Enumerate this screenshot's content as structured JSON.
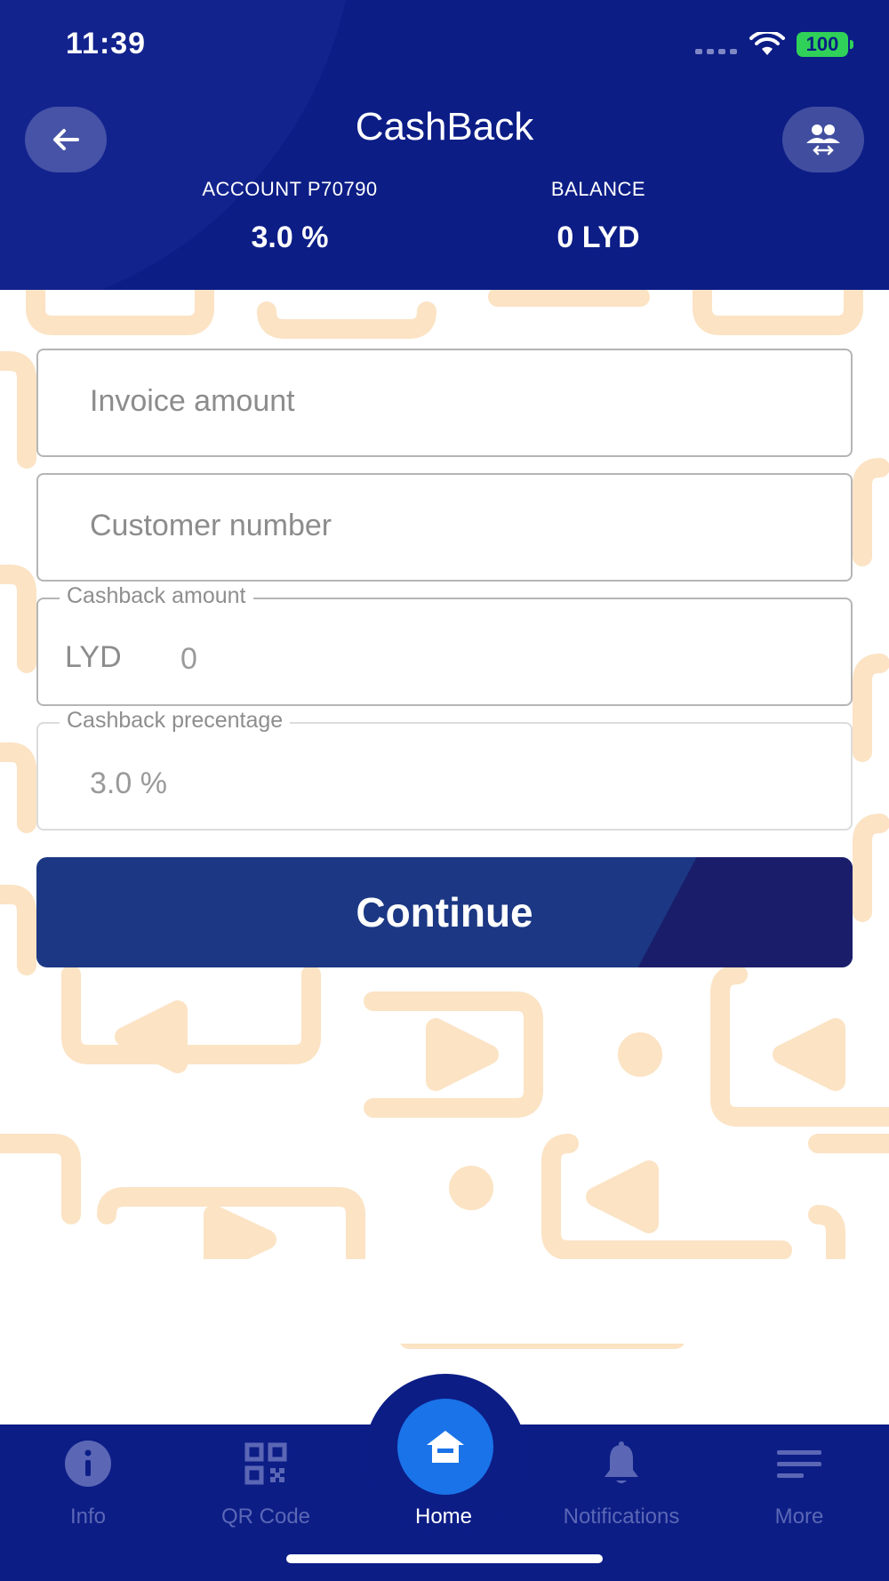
{
  "status_bar": {
    "time": "11:39",
    "battery": "100"
  },
  "header": {
    "title": "CashBack",
    "account_label": "ACCOUNT P70790",
    "account_value": "3.0 %",
    "balance_label": "BALANCE",
    "balance_value": "0 LYD"
  },
  "form": {
    "invoice_placeholder": "Invoice amount",
    "customer_placeholder": "Customer number",
    "cashback_label": "Cashback amount",
    "cashback_currency": "LYD",
    "cashback_value": "0",
    "percentage_label": "Cashback precentage",
    "percentage_value": "3.0 %",
    "continue_label": "Continue"
  },
  "nav": {
    "items": [
      {
        "label": "Info",
        "icon": "info-icon"
      },
      {
        "label": "QR Code",
        "icon": "qr-code-icon"
      },
      {
        "label": "Home",
        "icon": "home-icon",
        "active": true
      },
      {
        "label": "Notifications",
        "icon": "bell-icon"
      },
      {
        "label": "More",
        "icon": "menu-icon"
      }
    ]
  },
  "colors": {
    "header_bg": "#0c1d86",
    "button_bg": "#1c3884",
    "home_accent": "#1a73e8",
    "pattern": "#fbe3c4",
    "battery": "#30d158"
  }
}
